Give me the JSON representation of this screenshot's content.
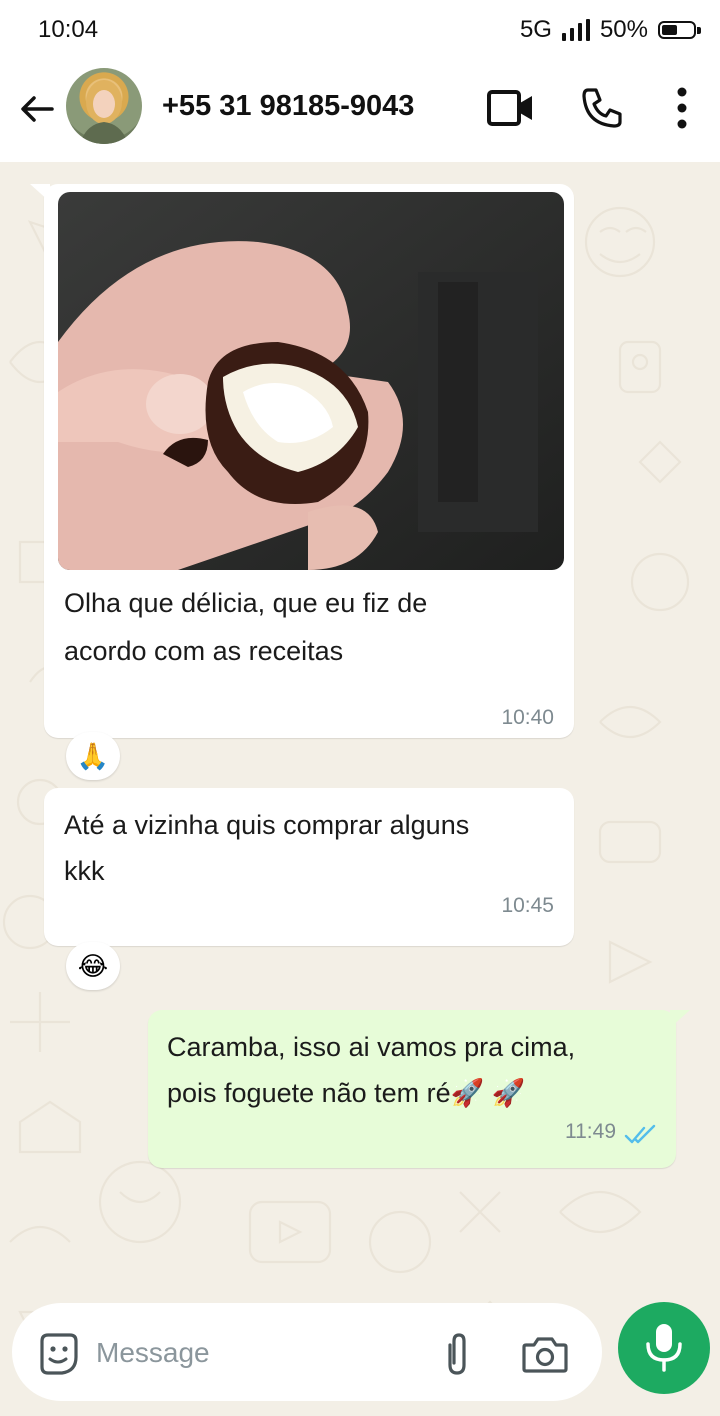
{
  "status_bar": {
    "time": "10:04",
    "network": "5G",
    "battery": "50%",
    "battery_level": 0.5
  },
  "header": {
    "contact": "+55 31 98185-9043",
    "icons": [
      "back-arrow-icon",
      "video-call-icon",
      "phone-icon",
      "more-vert-icon"
    ]
  },
  "messages": [
    {
      "direction": "incoming",
      "has_image": true,
      "image_description_icon": "chocolate-bonbon-photo",
      "text_line1": "Olha que délicia, que eu fiz de",
      "text_line2": "acordo com as receitas",
      "time": "10:40",
      "reaction": "🙏"
    },
    {
      "direction": "incoming",
      "text_line1": "Até a vizinha quis comprar alguns",
      "text_line2": "kkk",
      "time": "10:45",
      "reaction": "😂"
    },
    {
      "direction": "outgoing",
      "text_line1": "Caramba, isso ai vamos pra cima,",
      "text_line2": "pois foguete não tem ré🚀 🚀",
      "time": "11:49",
      "status": "read"
    }
  ],
  "input": {
    "placeholder": "Message",
    "icons": [
      "sticker-icon",
      "attach-icon",
      "camera-icon",
      "mic-icon"
    ]
  },
  "colors": {
    "accent": "#1daa61",
    "outgoing_bubble": "#e7fcd8",
    "chat_background": "#f3efe6",
    "read_ticks": "#53bdeb"
  }
}
